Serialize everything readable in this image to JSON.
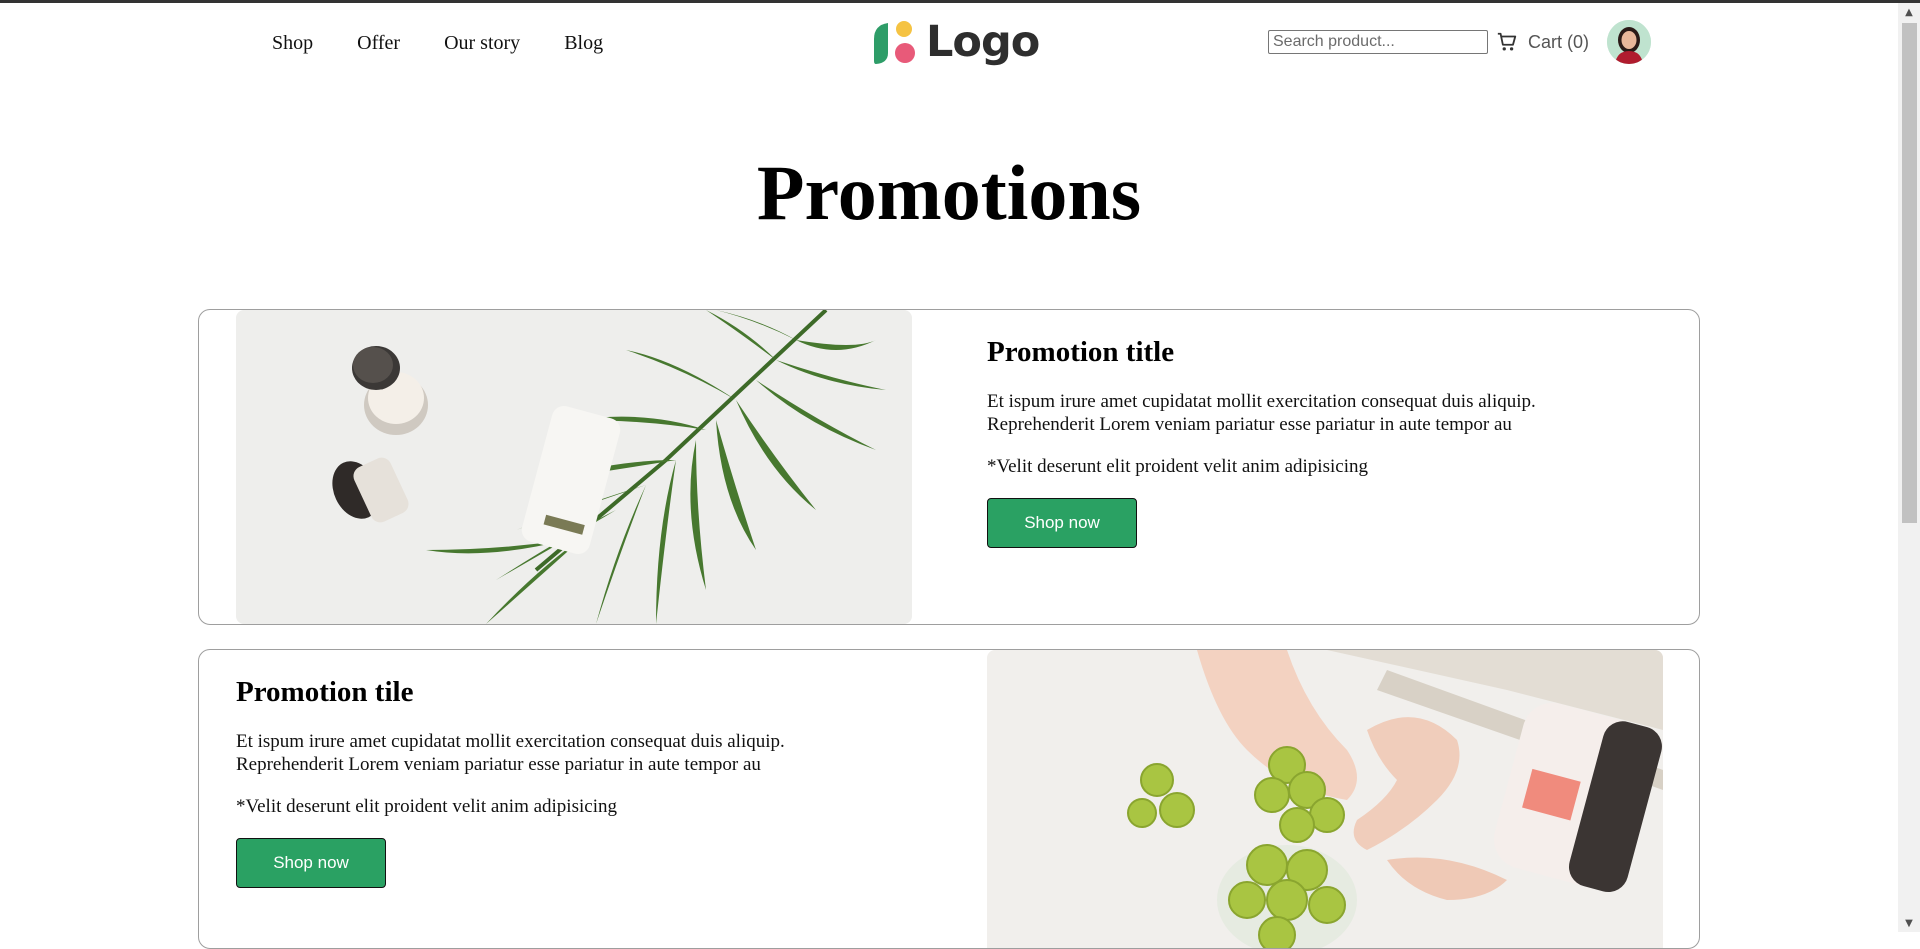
{
  "nav": {
    "items": [
      {
        "label": "Shop"
      },
      {
        "label": "Offer"
      },
      {
        "label": "Our story"
      },
      {
        "label": "Blog"
      }
    ]
  },
  "logo": {
    "text": "Logo"
  },
  "search": {
    "placeholder": "Search product..."
  },
  "cart": {
    "label": "Cart (0)"
  },
  "page": {
    "title": "Promotions"
  },
  "promotions": [
    {
      "title": "Promotion title",
      "body": "Et ispum irure amet cupidatat mollit exercitation consequat duis aliquip. Reprehenderit Lorem veniam pariatur esse pariatur in aute tempor au",
      "note": "*Velit deserunt elit proident velit anim adipisicing",
      "button": "Shop now",
      "image": "cosmetics-jars-with-palm-leaf"
    },
    {
      "title": "Promotion tile",
      "body": "Et ispum irure amet cupidatat mollit exercitation consequat duis aliquip. Reprehenderit Lorem veniam pariatur esse pariatur in aute tempor au",
      "note": "*Velit deserunt elit proident velit anim adipisicing",
      "button": "Shop now",
      "image": "hands-holding-green-gummies"
    }
  ],
  "colors": {
    "accent": "#2aa163",
    "logo_green": "#2e9d68",
    "logo_yellow": "#f5c343",
    "logo_pink": "#e85a79"
  }
}
